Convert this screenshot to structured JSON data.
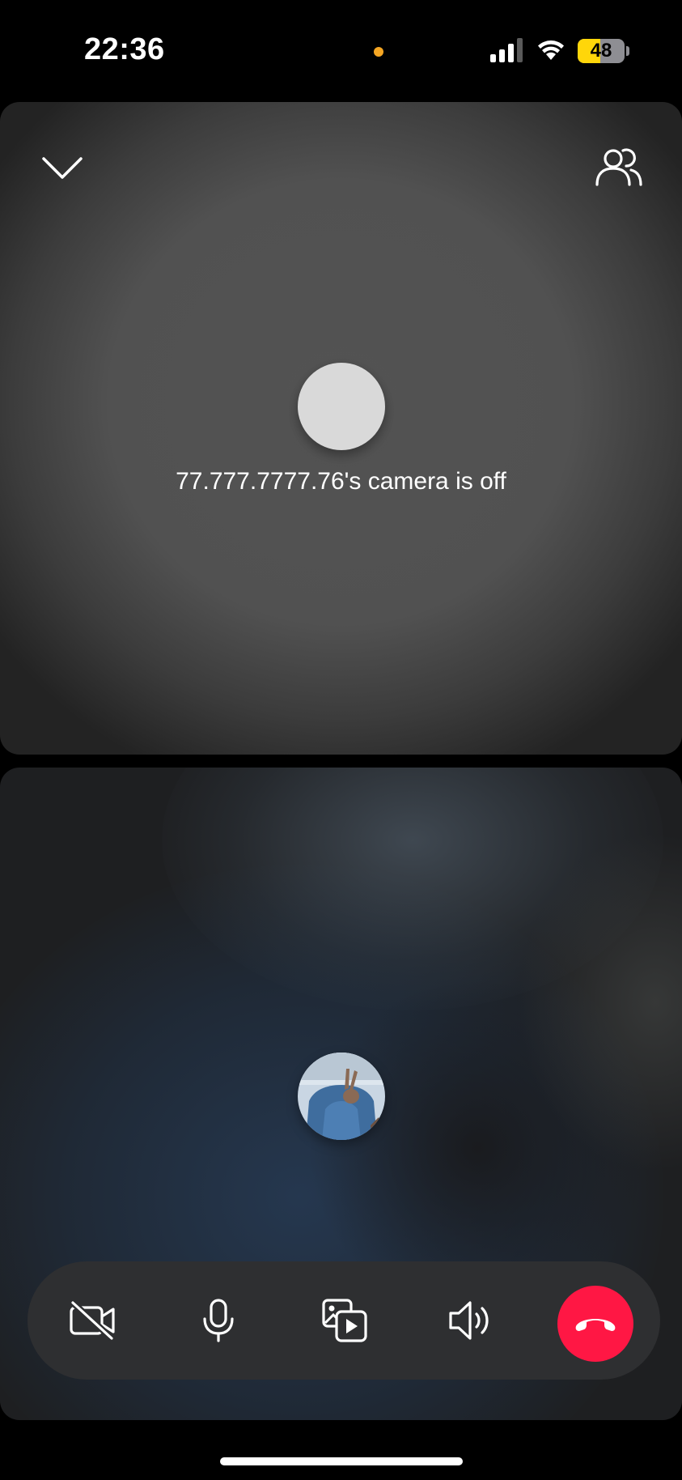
{
  "status_bar": {
    "time": "22:36",
    "battery_level": "48",
    "battery_fraction": 0.48,
    "recording_dot_color": "#f5a623"
  },
  "remote_participant": {
    "camera_off_message": "77.777.7777.76's camera is off",
    "avatar_color": "#d9d9d9"
  },
  "local_participant": {
    "avatar_description_icon": "user-photo-avatar"
  },
  "header": {
    "collapse_icon": "chevron-down-icon",
    "participants_icon": "participants-icon"
  },
  "controls": {
    "items": [
      {
        "name": "camera-toggle",
        "icon": "video-off-icon"
      },
      {
        "name": "microphone-toggle",
        "icon": "microphone-icon"
      },
      {
        "name": "share-media",
        "icon": "media-share-icon"
      },
      {
        "name": "speaker-toggle",
        "icon": "speaker-icon"
      },
      {
        "name": "end-call",
        "icon": "phone-hangup-icon"
      }
    ],
    "end_call_color": "#ff1744"
  }
}
